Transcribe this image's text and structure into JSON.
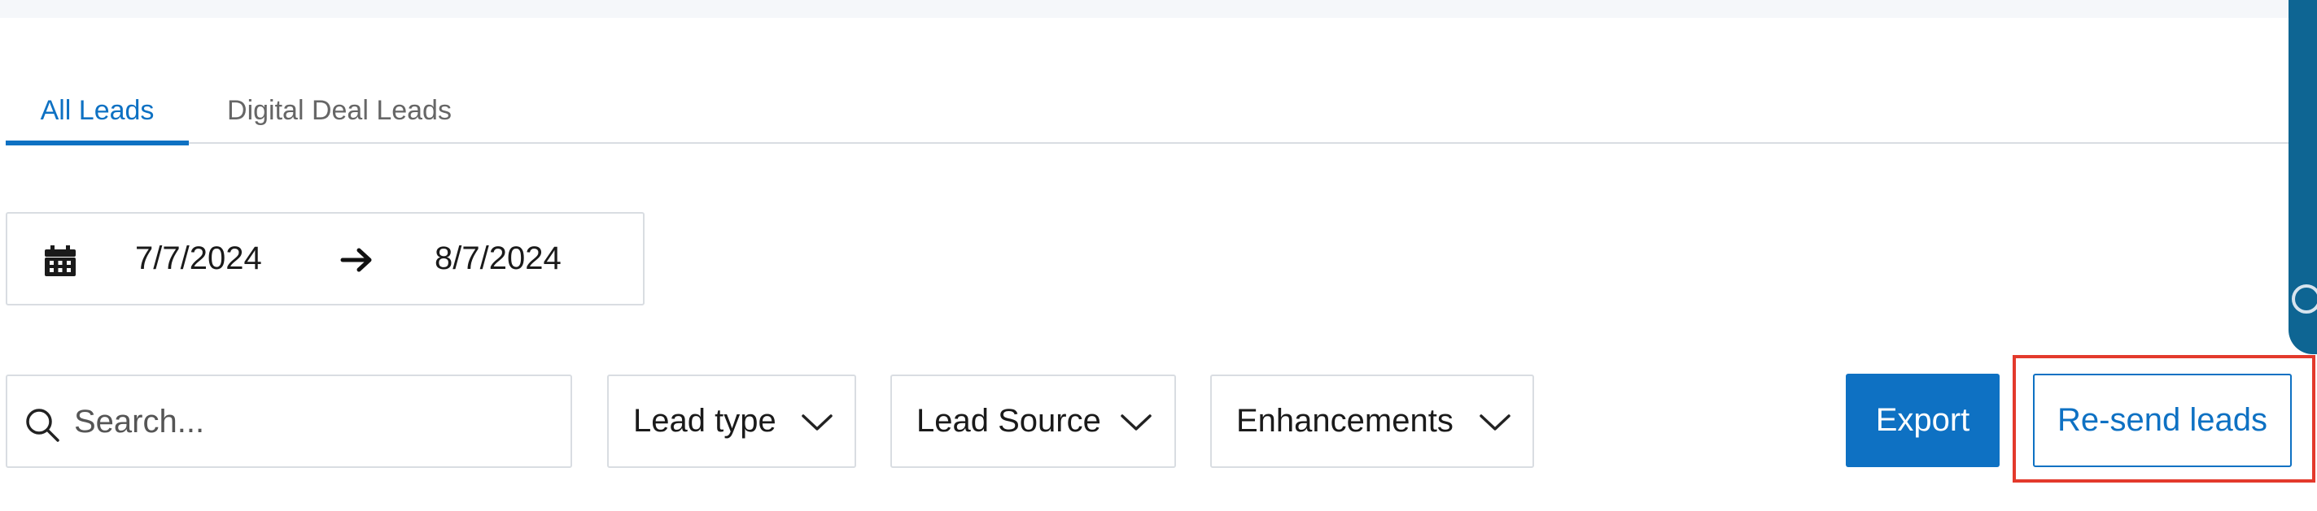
{
  "tabs": [
    {
      "label": "All Leads",
      "active": true
    },
    {
      "label": "Digital Deal Leads",
      "active": false
    }
  ],
  "date_range": {
    "start": "7/7/2024",
    "end": "8/7/2024"
  },
  "search": {
    "placeholder": "Search...",
    "value": ""
  },
  "filters": {
    "lead_type": "Lead type",
    "lead_source": "Lead Source",
    "enhancements": "Enhancements"
  },
  "actions": {
    "export_label": "Export",
    "resend_label": "Re-send leads"
  },
  "icons": {
    "calendar": "calendar-icon",
    "arrow": "arrow-right-icon",
    "search": "search-icon",
    "chevron": "chevron-down-icon"
  },
  "colors": {
    "accent": "#0e71c3",
    "side_panel": "#0e6593",
    "highlight": "#e33a2c"
  }
}
